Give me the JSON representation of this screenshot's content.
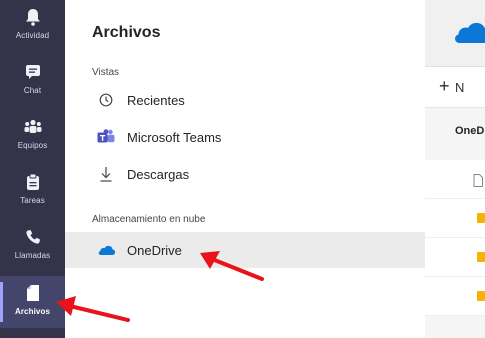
{
  "rail": {
    "items": [
      {
        "label": "Actividad",
        "icon": "bell-icon"
      },
      {
        "label": "Chat",
        "icon": "chat-icon"
      },
      {
        "label": "Equipos",
        "icon": "teams-icon"
      },
      {
        "label": "Tareas",
        "icon": "tasks-icon"
      },
      {
        "label": "Llamadas",
        "icon": "phone-icon"
      },
      {
        "label": "Archivos",
        "icon": "file-icon",
        "active": true
      }
    ]
  },
  "panel": {
    "title": "Archivos",
    "views_label": "Vistas",
    "views": [
      {
        "label": "Recientes",
        "icon": "clock-icon"
      },
      {
        "label": "Microsoft Teams",
        "icon": "ms-teams-icon"
      },
      {
        "label": "Descargas",
        "icon": "download-icon"
      }
    ],
    "cloud_label": "Almacenamiento en nube",
    "cloud": [
      {
        "label": "OneDrive",
        "icon": "onedrive-icon",
        "selected": true
      }
    ]
  },
  "right": {
    "new_label": "N",
    "breadcrumb": "OneD"
  },
  "colors": {
    "rail_bg": "#33344a",
    "accent": "#6264a7",
    "onedrive": "#0a78d4",
    "arrow": "#e8141a",
    "folder": "#f5b400"
  }
}
